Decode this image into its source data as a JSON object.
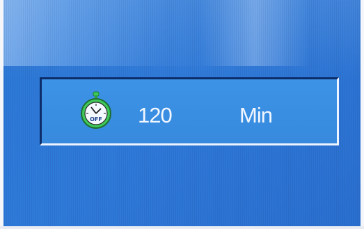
{
  "osd": {
    "icon": "sleep-timer-off-icon",
    "icon_text": "OFF",
    "value": "120",
    "unit": "Min"
  },
  "colors": {
    "screen_background": "#2c78d6",
    "panel_background": "#3a8ee0",
    "text": "#f2f7ff",
    "icon_accent": "#3fc85a"
  }
}
